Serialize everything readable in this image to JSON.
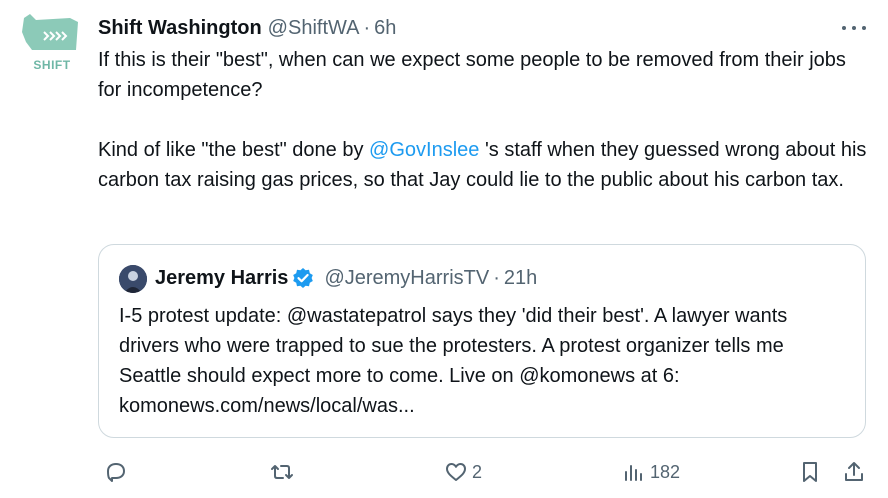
{
  "tweet": {
    "author_name": "Shift Washington",
    "author_handle": "@ShiftWA",
    "separator": "·",
    "time": "6h",
    "avatar_label": "SHIFT",
    "text_part1": "If this is their \"best\", when can we expect some people to be removed from their jobs for incompetence?\n\nKind of like \"the best\" done by ",
    "mention": "@GovInslee",
    "text_part2": " 's staff when they guessed wrong about his carbon tax raising gas prices, so that Jay could lie to the public about his carbon tax."
  },
  "quote": {
    "author_name": "Jeremy Harris",
    "author_handle": "@JeremyHarrisTV",
    "separator": "·",
    "time": "21h",
    "verified": true,
    "text": "I-5 protest update: @wastatepatrol  says they 'did their best'. A lawyer wants drivers who were trapped to sue the protesters. A protest organizer tells me Seattle should expect more to come. Live on @komonews at 6: komonews.com/news/local/was..."
  },
  "actions": {
    "reply_count": "",
    "retweet_count": "",
    "like_count": "2",
    "views_count": "182"
  },
  "colors": {
    "accent": "#1d9bf0",
    "muted": "#536471",
    "border": "#cfd9de",
    "shift_green": "#6fb7a6"
  }
}
